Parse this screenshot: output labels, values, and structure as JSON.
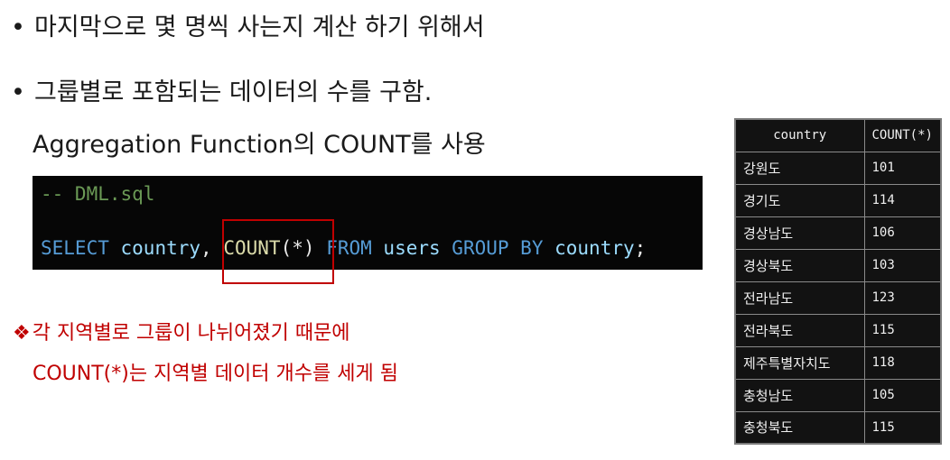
{
  "bullets": {
    "marker": "•",
    "line1": "마지막으로 몇 명씩 사는지 계산 하기 위해서",
    "line2": "그룹별로 포함되는 데이터의 수를 구함.",
    "line2_sub": "Aggregation Function의 COUNT를 사용"
  },
  "code": {
    "comment": "-- DML.sql",
    "tokens": {
      "select": "SELECT",
      "col": "country",
      "comma": ",",
      "space": " ",
      "count_fn": "COUNT",
      "open": "(",
      "star": "*",
      "close": ")",
      "from": "FROM",
      "table": "users",
      "group": "GROUP",
      "by": "BY",
      "col2": "country",
      "semi": ";"
    }
  },
  "note": {
    "marker": "❖",
    "line1": "각 지역별로 그룹이 나뉘어졌기 때문에",
    "line2": "COUNT(*)는 지역별 데이터 개수를 세게 됨"
  },
  "result_table": {
    "headers": [
      "country",
      "COUNT(*)"
    ],
    "rows": [
      [
        "강원도",
        "101"
      ],
      [
        "경기도",
        "114"
      ],
      [
        "경상남도",
        "106"
      ],
      [
        "경상북도",
        "103"
      ],
      [
        "전라남도",
        "123"
      ],
      [
        "전라북도",
        "115"
      ],
      [
        "제주특별자치도",
        "118"
      ],
      [
        "충청남도",
        "105"
      ],
      [
        "충청북도",
        "115"
      ]
    ]
  },
  "colors": {
    "code_bg": "#060606",
    "comment": "#6a9955",
    "keyword": "#569cd6",
    "identifier": "#9cdcfe",
    "function": "#dcdcaa",
    "highlight": "#c00000"
  }
}
